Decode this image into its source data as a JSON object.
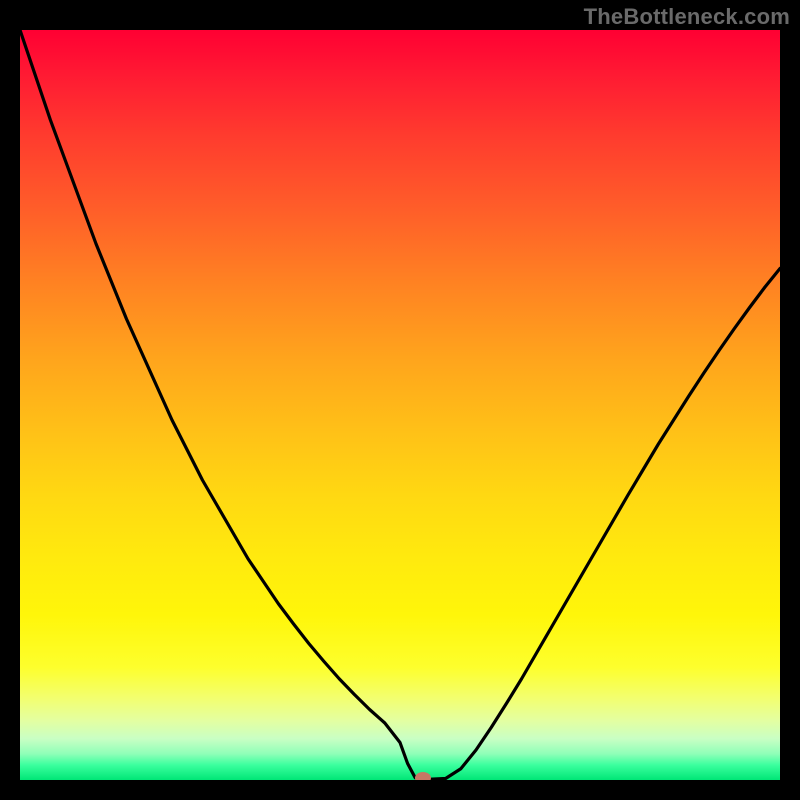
{
  "watermark": "TheBottleneck.com",
  "colors": {
    "frame": "#000000",
    "curve": "#000000",
    "marker": "#c77764"
  },
  "chart_data": {
    "type": "line",
    "title": "",
    "xlabel": "",
    "ylabel": "",
    "xlim": [
      0,
      100
    ],
    "ylim": [
      0,
      100
    ],
    "grid": false,
    "legend_position": "none",
    "series": [
      {
        "name": "bottleneck-curve",
        "x": [
          0,
          2,
          4,
          6,
          8,
          10,
          12,
          14,
          16,
          18,
          20,
          22,
          24,
          26,
          28,
          30,
          32,
          34,
          36,
          38,
          40,
          42,
          44,
          46,
          48,
          50,
          51,
          52,
          53,
          54,
          56,
          58,
          60,
          62,
          64,
          66,
          68,
          70,
          72,
          74,
          76,
          78,
          80,
          82,
          84,
          86,
          88,
          90,
          92,
          94,
          96,
          98,
          100
        ],
        "y": [
          100,
          94,
          88,
          82.5,
          77,
          71.5,
          66.5,
          61.5,
          57,
          52.5,
          48,
          44,
          40,
          36.5,
          33,
          29.5,
          26.5,
          23.5,
          20.8,
          18.2,
          15.8,
          13.5,
          11.4,
          9.4,
          7.6,
          5.0,
          2.2,
          0.3,
          0.1,
          0.1,
          0.2,
          1.5,
          4.0,
          7.0,
          10.2,
          13.5,
          17.0,
          20.5,
          24.0,
          27.5,
          31.0,
          34.5,
          38.0,
          41.4,
          44.8,
          48.0,
          51.2,
          54.3,
          57.3,
          60.2,
          63.0,
          65.7,
          68.2
        ]
      }
    ],
    "marker": {
      "x": 53,
      "y": 0.3
    },
    "background_gradient": {
      "direction": "vertical",
      "stops": [
        {
          "pos": 0.0,
          "color": "#ff0033"
        },
        {
          "pos": 0.5,
          "color": "#ffc217"
        },
        {
          "pos": 0.8,
          "color": "#fdff2d"
        },
        {
          "pos": 0.96,
          "color": "#8fffb8"
        },
        {
          "pos": 1.0,
          "color": "#00e676"
        }
      ]
    }
  }
}
